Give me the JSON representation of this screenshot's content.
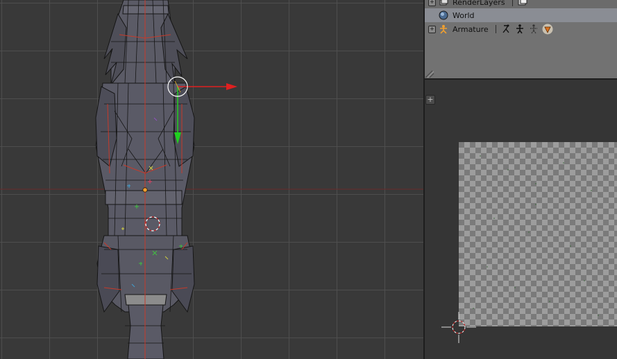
{
  "outliner": {
    "rows": [
      {
        "label": "RenderLayers",
        "icon": "render-layers-icon"
      },
      {
        "label": "World",
        "icon": "world-icon"
      },
      {
        "label": "Armature",
        "icon": "armature-icon"
      }
    ],
    "armature_icons": [
      "pose-icon",
      "bone-icon",
      "bone-group-icon",
      "modifier-icon"
    ]
  },
  "colors": {
    "viewport_bg": "#393939",
    "grid_line": "#505050",
    "x_axis": "#e02020",
    "y_axis": "#20d020",
    "mesh_fill": "#5a5a66",
    "mesh_edge": "#141414",
    "seam": "#c23a2a",
    "outliner_bg": "#727272",
    "selected_row": "#8a8d94",
    "uv_bg": "#353535",
    "checker_light": "#9d9d9d",
    "checker_dark": "#7a7a7a"
  }
}
